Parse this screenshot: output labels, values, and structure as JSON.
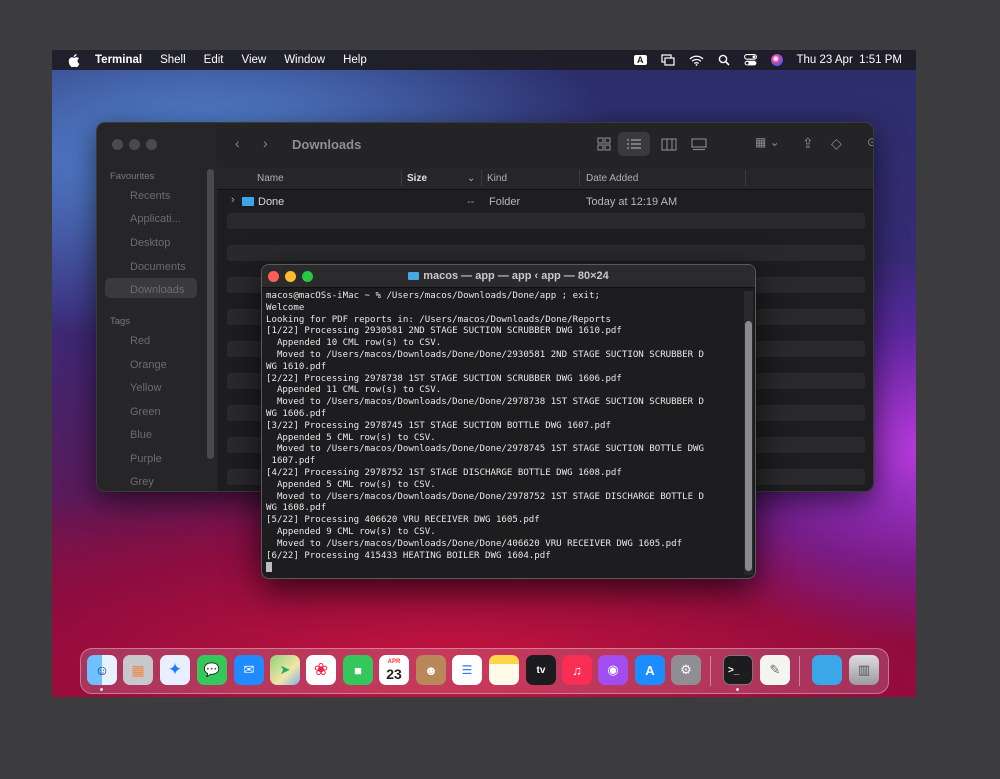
{
  "menubar": {
    "app_name": "Terminal",
    "items": [
      "Shell",
      "Edit",
      "View",
      "Window",
      "Help"
    ],
    "input_source": "A",
    "clock": "Thu 23 Apr  1:51 PM"
  },
  "finder": {
    "title": "Downloads",
    "sidebar": {
      "favourites_heading": "Favourites",
      "favourites": [
        "Recents",
        "Applicati...",
        "Desktop",
        "Documents",
        "Downloads"
      ],
      "tags_heading": "Tags",
      "tags": [
        "Red",
        "Orange",
        "Yellow",
        "Green",
        "Blue",
        "Purple",
        "Grey"
      ]
    },
    "columns": {
      "name": "Name",
      "size": "Size",
      "kind": "Kind",
      "date": "Date Added"
    },
    "rows": [
      {
        "name": "Done",
        "size": "--",
        "kind": "Folder",
        "date": "Today at 12:19 AM"
      }
    ]
  },
  "terminal": {
    "title": "macos — app — app ‹ app — 80×24",
    "lines": [
      "macos@macOSs-iMac ~ % /Users/macos/Downloads/Done/app ; exit;",
      "Welcome",
      "Looking for PDF reports in: /Users/macos/Downloads/Done/Reports",
      "[1/22] Processing 2930581 2ND STAGE SUCTION SCRUBBER DWG 1610.pdf",
      "  Appended 10 CML row(s) to CSV.",
      "  Moved to /Users/macos/Downloads/Done/Done/2930581 2ND STAGE SUCTION SCRUBBER D",
      "WG 1610.pdf",
      "[2/22] Processing 2978738 1ST STAGE SUCTION SCRUBBER DWG 1606.pdf",
      "  Appended 11 CML row(s) to CSV.",
      "  Moved to /Users/macos/Downloads/Done/Done/2978738 1ST STAGE SUCTION SCRUBBER D",
      "WG 1606.pdf",
      "[3/22] Processing 2978745 1ST STAGE SUCTION BOTTLE DWG 1607.pdf",
      "  Appended 5 CML row(s) to CSV.",
      "  Moved to /Users/macos/Downloads/Done/Done/2978745 1ST STAGE SUCTION BOTTLE DWG",
      " 1607.pdf",
      "[4/22] Processing 2978752 1ST STAGE DISCHARGE BOTTLE DWG 1608.pdf",
      "  Appended 5 CML row(s) to CSV.",
      "  Moved to /Users/macos/Downloads/Done/Done/2978752 1ST STAGE DISCHARGE BOTTLE D",
      "WG 1608.pdf",
      "[5/22] Processing 406620 VRU RECEIVER DWG 1605.pdf",
      "  Appended 9 CML row(s) to CSV.",
      "  Moved to /Users/macos/Downloads/Done/Done/406620 VRU RECEIVER DWG 1605.pdf",
      "[6/22] Processing 415433 HEATING BOILER DWG 1604.pdf"
    ]
  },
  "dock": {
    "calendar_month": "APR",
    "calendar_day": "23",
    "tv_label": "tv",
    "apps": [
      "finder-icon",
      "launchpad-icon",
      "safari-icon",
      "messages-icon",
      "mail-icon",
      "maps-icon",
      "photos-icon",
      "facetime-icon",
      "calendar-icon",
      "contacts-icon",
      "reminders-icon",
      "notes-icon",
      "tv-icon",
      "music-icon",
      "podcasts-icon",
      "app-store-icon",
      "system-preferences-icon",
      "terminal-icon",
      "textedit-icon",
      "downloads-folder-icon",
      "trash-icon"
    ]
  }
}
